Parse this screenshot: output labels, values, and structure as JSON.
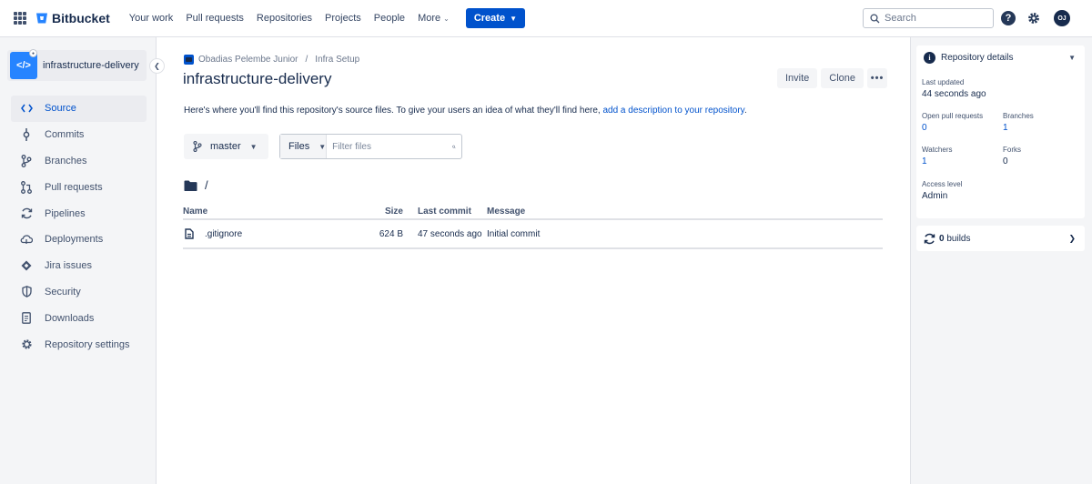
{
  "topnav": {
    "product": "Bitbucket",
    "links": [
      "Your work",
      "Pull requests",
      "Repositories",
      "Projects",
      "People"
    ],
    "more_label": "More",
    "create_label": "Create",
    "search_placeholder": "Search",
    "avatar_initials": "OJ",
    "help_icon": "question-icon",
    "settings_icon": "gear-icon",
    "brand_color": "#0052cc"
  },
  "sidebar": {
    "repo_name": "infrastructure-delivery",
    "items": [
      {
        "label": "Source",
        "icon": "code-icon",
        "active": true
      },
      {
        "label": "Commits",
        "icon": "commit-icon",
        "active": false
      },
      {
        "label": "Branches",
        "icon": "branch-icon",
        "active": false
      },
      {
        "label": "Pull requests",
        "icon": "pull-request-icon",
        "active": false
      },
      {
        "label": "Pipelines",
        "icon": "pipelines-icon",
        "active": false
      },
      {
        "label": "Deployments",
        "icon": "cloud-icon",
        "active": false
      },
      {
        "label": "Jira issues",
        "icon": "jira-icon",
        "active": false
      },
      {
        "label": "Security",
        "icon": "shield-icon",
        "active": false
      },
      {
        "label": "Downloads",
        "icon": "document-icon",
        "active": false
      },
      {
        "label": "Repository settings",
        "icon": "gear-icon",
        "active": false
      }
    ]
  },
  "main": {
    "breadcrumb": {
      "workspace": "Obadias Pelembe Junior",
      "sep": "/",
      "project": "Infra Setup"
    },
    "title": "infrastructure-delivery",
    "actions": {
      "invite": "Invite",
      "clone": "Clone",
      "more": "•••"
    },
    "description": {
      "text": "Here's where you'll find this repository's source files. To give your users an idea of what they'll find here, ",
      "link": "add a description to your repository",
      "end": "."
    },
    "branch": "master",
    "filter": {
      "mode": "Files",
      "placeholder": "Filter files"
    },
    "path": "/",
    "table": {
      "headers": {
        "name": "Name",
        "size": "Size",
        "last_commit": "Last commit",
        "message": "Message"
      },
      "rows": [
        {
          "name": ".gitignore",
          "size": "624 B",
          "last_commit": "47 seconds ago",
          "message": "Initial commit"
        }
      ]
    }
  },
  "details": {
    "title": "Repository details",
    "last_updated_label": "Last updated",
    "last_updated": "44 seconds ago",
    "open_prs_label": "Open pull requests",
    "open_prs": "0",
    "branches_label": "Branches",
    "branches": "1",
    "watchers_label": "Watchers",
    "watchers": "1",
    "forks_label": "Forks",
    "forks": "0",
    "access_label": "Access level",
    "access": "Admin",
    "builds_count": "0",
    "builds_label": "builds"
  }
}
